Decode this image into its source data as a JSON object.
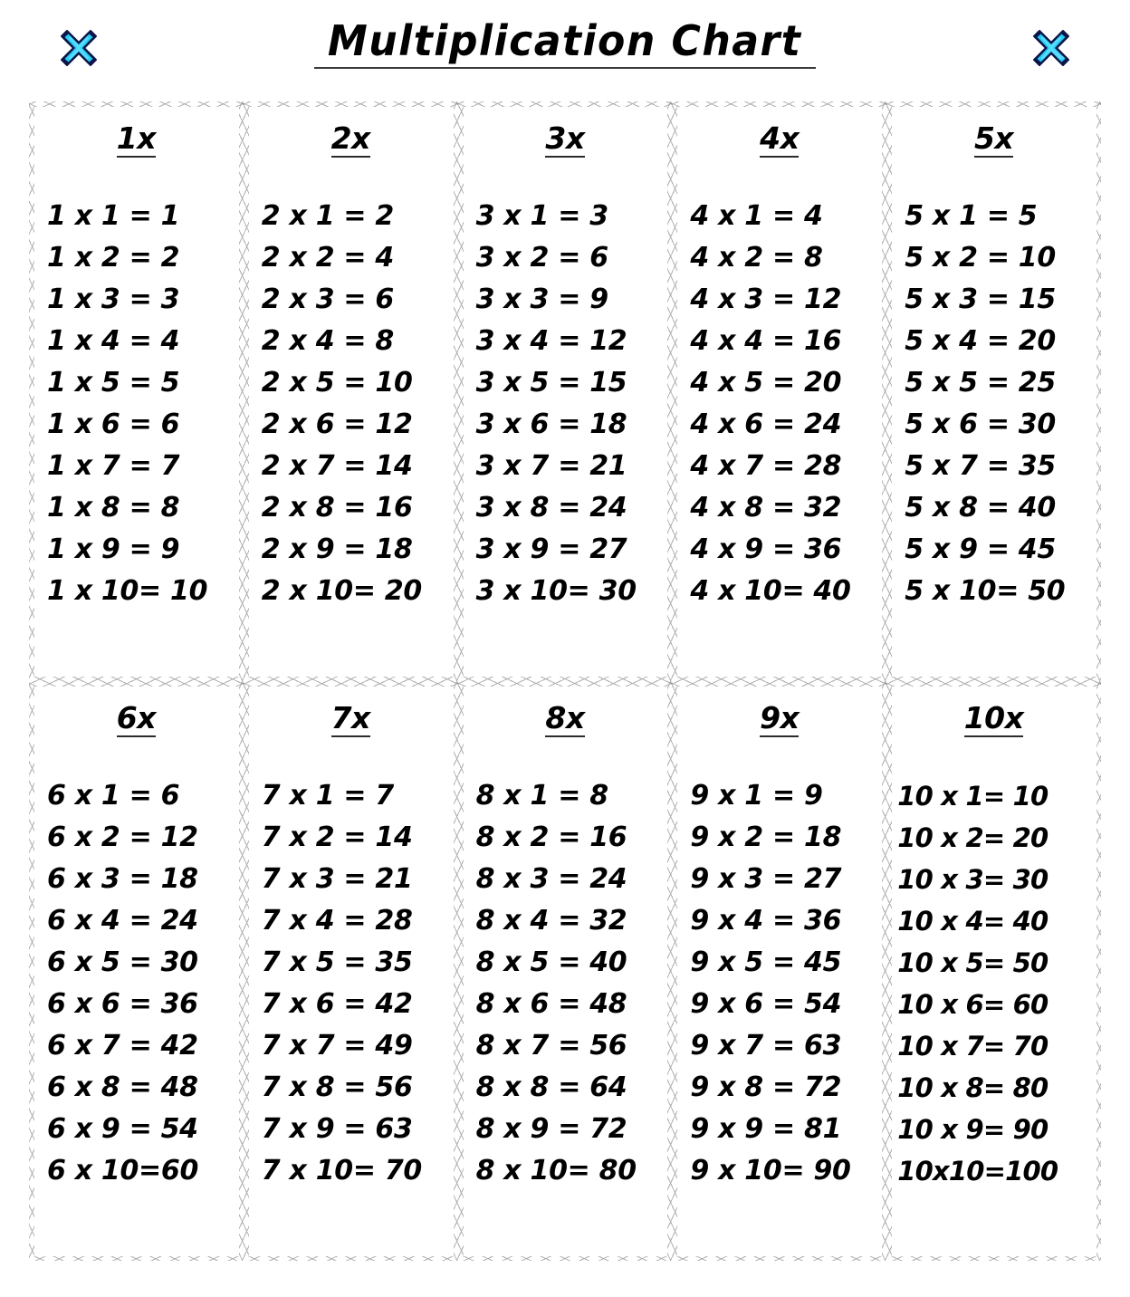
{
  "header": {
    "title": "Multiplication Chart",
    "left_icon": "x-mark-icon",
    "right_icon": "x-mark-icon",
    "icon_color": "#22ccf5",
    "icon_outline_color": "#0b1547",
    "title_color": "#000000"
  },
  "chart_data": {
    "type": "table",
    "title": "Multiplication Chart",
    "rows": 2,
    "columns": 5,
    "tables": [
      {
        "header": "1x",
        "multiplier": 1,
        "facts": [
          "1 x 1 = 1",
          "1 x 2 = 2",
          "1 x 3 = 3",
          "1 x 4 = 4",
          "1 x 5 = 5",
          "1 x 6 = 6",
          "1 x 7 = 7",
          "1 x 8 = 8",
          "1 x 9 = 9",
          "1 x 10= 10"
        ]
      },
      {
        "header": "2x",
        "multiplier": 2,
        "facts": [
          "2 x 1 = 2",
          "2 x 2 = 4",
          "2 x 3 = 6",
          "2 x 4 = 8",
          "2 x 5 = 10",
          "2 x 6 = 12",
          "2 x 7 = 14",
          "2 x 8 = 16",
          "2 x 9 = 18",
          "2 x 10= 20"
        ]
      },
      {
        "header": "3x",
        "multiplier": 3,
        "facts": [
          "3 x 1 = 3",
          "3 x 2 = 6",
          "3 x 3 = 9",
          "3 x 4 = 12",
          "3 x 5 = 15",
          "3 x 6 = 18",
          "3 x 7 = 21",
          "3 x 8 = 24",
          "3 x 9 = 27",
          "3 x 10= 30"
        ]
      },
      {
        "header": "4x",
        "multiplier": 4,
        "facts": [
          "4 x 1 = 4",
          "4 x 2 = 8",
          "4 x 3 = 12",
          "4 x 4 = 16",
          "4 x 5 = 20",
          "4 x 6 = 24",
          "4 x 7 = 28",
          "4 x 8 = 32",
          "4 x 9 = 36",
          "4 x 10= 40"
        ]
      },
      {
        "header": "5x",
        "multiplier": 5,
        "facts": [
          "5 x 1 = 5",
          "5 x 2 = 10",
          "5 x 3 = 15",
          "5 x 4 = 20",
          "5 x 5 = 25",
          "5 x 6 = 30",
          "5 x 7 = 35",
          "5 x 8 = 40",
          "5 x 9 = 45",
          "5 x 10= 50"
        ]
      },
      {
        "header": "6x",
        "multiplier": 6,
        "facts": [
          "6 x 1 = 6",
          "6 x 2 = 12",
          "6 x 3 = 18",
          "6 x 4 = 24",
          "6 x 5 = 30",
          "6 x 6 = 36",
          "6 x 7 = 42",
          "6 x 8 = 48",
          "6 x 9 = 54",
          "6 x 10=60"
        ]
      },
      {
        "header": "7x",
        "multiplier": 7,
        "facts": [
          "7 x 1 = 7",
          "7 x 2 = 14",
          "7 x 3 = 21",
          "7 x 4 = 28",
          "7 x 5 = 35",
          "7 x 6 = 42",
          "7 x 7 = 49",
          "7 x 8 = 56",
          "7 x 9 = 63",
          "7 x 10= 70"
        ]
      },
      {
        "header": "8x",
        "multiplier": 8,
        "facts": [
          "8 x 1 = 8",
          "8 x 2 = 16",
          "8 x 3 = 24",
          "8 x 4 = 32",
          "8 x 5 = 40",
          "8 x 6 = 48",
          "8 x 7 = 56",
          "8 x 8 = 64",
          "8 x 9 = 72",
          "8 x 10= 80"
        ]
      },
      {
        "header": "9x",
        "multiplier": 9,
        "facts": [
          "9 x 1 = 9",
          "9 x 2 = 18",
          "9 x 3 = 27",
          "9 x 4 = 36",
          "9 x 5 = 45",
          "9 x 6 = 54",
          "9 x 7 = 63",
          "9 x 8 = 72",
          "9 x 9 = 81",
          "9 x 10= 90"
        ]
      },
      {
        "header": "10x",
        "multiplier": 10,
        "facts": [
          "10 x 1= 10",
          "10 x 2= 20",
          "10 x 3= 30",
          "10 x 4= 40",
          "10 x 5= 50",
          "10 x 6= 60",
          "10 x 7= 70",
          "10 x 8= 80",
          "10 x 9= 90",
          "10x10=100"
        ]
      }
    ]
  }
}
